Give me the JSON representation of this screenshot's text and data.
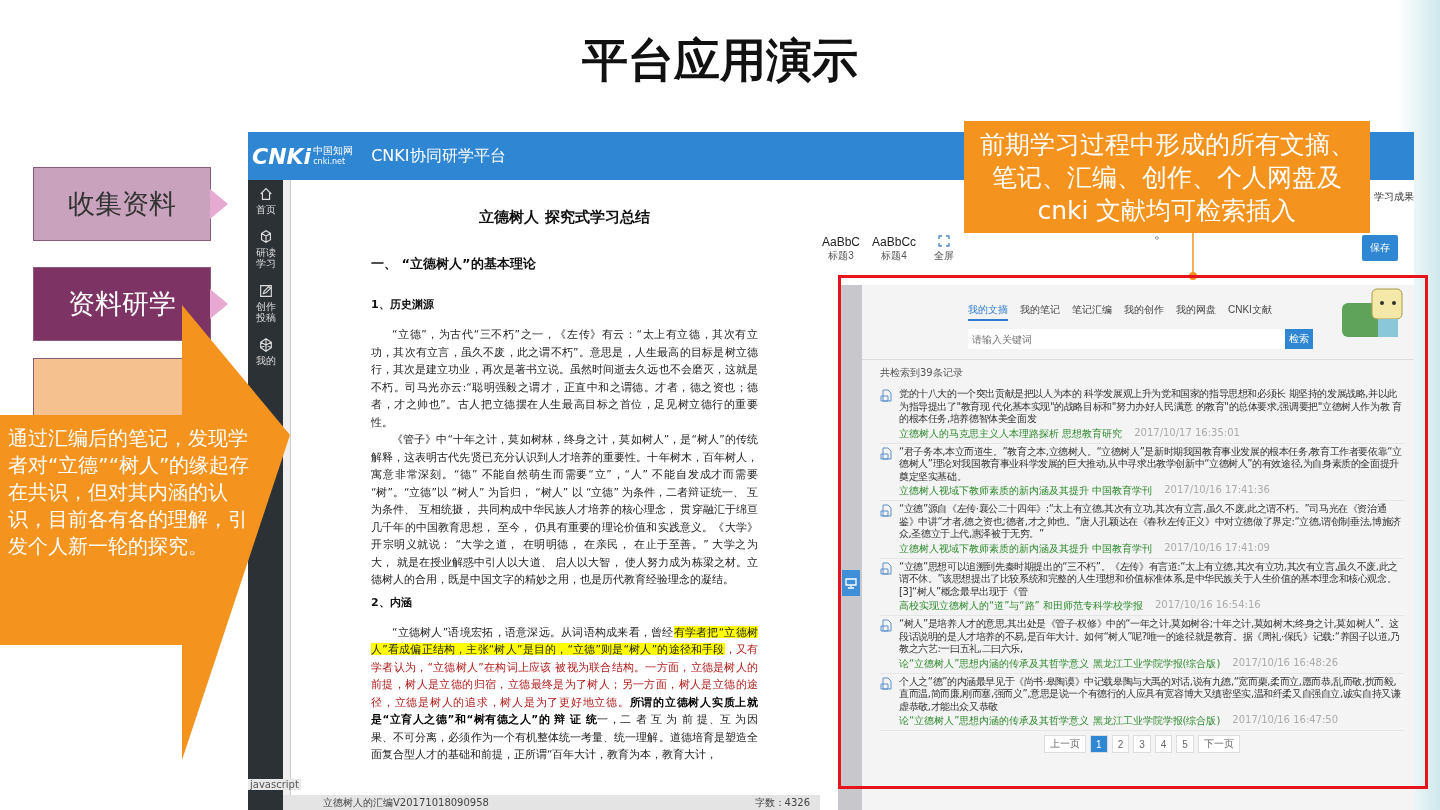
{
  "slide": {
    "title": "平台应用演示",
    "steps": [
      {
        "label": "收集资料",
        "kind": "light"
      },
      {
        "label": "资料研学",
        "kind": "dark"
      },
      {
        "kind": "peach"
      }
    ],
    "arrow_callout": "通过汇编后的笔记，发现学者对“立德”“树人”的缘起存在共识，但对其内涵的认识，目前各有各的理解，引发个人新一轮的探究。",
    "top_callout": "前期学习过程中形成的所有文摘、笔记、汇编、创作、个人网盘及 cnki 文献均可检索插入",
    "stray_mark": "。"
  },
  "app": {
    "logo": "CNKi",
    "logo_cn": "中国知网",
    "logo_url": "cnki.net",
    "title": "CNKI协同研学平台",
    "sidebar": [
      {
        "label": "首页"
      },
      {
        "label": "研读学习"
      },
      {
        "label": "创作投稿"
      },
      {
        "label": "我的"
      }
    ],
    "sidebar_footer": "javascript",
    "toolbar": {
      "styles": [
        {
          "sample": "AaBbC",
          "name": "标题3"
        },
        {
          "sample": "AaBbCc",
          "name": "标题4"
        }
      ],
      "fullscreen": "全屏",
      "save": "保存",
      "right_tab": "学习成果"
    },
    "document": {
      "title": "立德树人  探究式学习总结",
      "blocks": [
        {
          "kind": "h1",
          "text": "一、 “立德树人”的基本理论"
        },
        {
          "kind": "h2",
          "text": "1、历史渊源"
        },
        {
          "kind": "p",
          "segments": [
            {
              "kind": "plain",
              "text": "“立德”，为古代“三不朽”之一，《左传》有云：“太上有立德，其次有立功，其次有立言，虽久不废，此之谓不朽”。意思是，人生最高的目标是树立德行，其次是建立功业，再次是著书立说。虽然时间逝去久远也不会磨灭，这就是不朽。司马光亦云:“聪明强毅之谓才，正直中和之谓德。才者，德之资也；德者，才之帅也”。古人把立德摆在人生最高目标之首位，足见树立德行的重要性。"
            }
          ]
        },
        {
          "kind": "p",
          "segments": [
            {
              "kind": "plain",
              "text": "《管子》中“十年之计，莫如树林，终身之计，莫如树人”，是“树人”的传统解释，这表明古代先贤已充分认识到人才培养的重要性。十年树木，百年树人，寓意非常深刻。“德” 不能自然萌生而需要“立”，“人” 不能自发成才而需要 “树”。“立德”以 “树人” 为旨归， “树人” 以 “立德” 为条件，二者辩证统一、 互为条件、 互相统摄， 共同构成中华民族人才培养的核心理念， 贯穿融汇于绵亘几千年的中国教育思想， 至今， 仍具有重要的理论价值和实践意义。《大学》开宗明义就说： “大学之道， 在明明德， 在亲民， 在止于至善。” 大学之为大， 就是在授业解惑中引人以大道、 启人以大智， 使人努力成为栋梁之材。立德树人的合用，既是中国文字的精妙之用，也是历代教育经验理念的凝结。"
            }
          ]
        },
        {
          "kind": "h2",
          "text": "2、内涵"
        },
        {
          "kind": "p",
          "segments": [
            {
              "kind": "plain",
              "text": "“立德树人”语境宏拓，语意深远。从词语构成来看，曾经"
            },
            {
              "kind": "highlight",
              "text": "有学者把“立德树人”看成偏正结构，主张“树人”是目的，“立德”则是“树人”的途径和手段"
            },
            {
              "kind": "red",
              "text": "，又有学者认为，“立德树人”在构词上应该 被视为联合结构。一方面，立德是树人的前提，树人是立德的归宿，立德最终是为了树人；另一方面，树人是立德的途径，立德是树人的追求，树人是为了更好地立德。"
            },
            {
              "kind": "bold",
              "text": "所谓的立德树人实质上就是“立育人之德”和“树有德之人”的 辩 证 统"
            },
            {
              "kind": "plain",
              "text": "一，二 者 互 为 前 提、互 为因果、不可分离，必须作为一个有机整体统一考量、统一理解。道德培育是塑造全面复合型人才的基础和前提，正所谓“百年大计，教育为本，教育大计，"
            }
          ]
        }
      ],
      "status_name": "立德树人的汇编V20171018090958",
      "status_count": "字数：4326"
    },
    "panel": {
      "tabs": [
        {
          "label": "我的文摘",
          "selected": true
        },
        {
          "label": "我的笔记",
          "selected": false
        },
        {
          "label": "笔记汇编",
          "selected": false
        },
        {
          "label": "我的创作",
          "selected": false
        },
        {
          "label": "我的网盘",
          "selected": false
        },
        {
          "label": "CNKI文献",
          "selected": false
        }
      ],
      "search": {
        "placeholder": "请输入关键词",
        "button": "检索"
      },
      "count": "共检索到39条记录",
      "results": [
        {
          "text": "党的十八大的一个突出贡献是把以人为本的 科学发展观上升为党和国家的指导思想和必须长 期坚持的发展战略,并以此为指导提出了\"教育现 代化基本实现\"的战略目标和\"努力办好人民满意 的教育\"的总体要求,强调要把\"立德树人作为教 育的根本任务,培养德智体美全面发",
          "source": "立德树人的马克思主义人本理路探析 思想教育研究",
          "time": "2017/10/17 16:35:01"
        },
        {
          "text": "“君子务本,本立而道生。”教育之本,立德树人。“立德树人”是新时期我国教育事业发展的根本任务,教育工作者要依靠“立德树人”理论对我国教育事业科学发展的巨大推动,从中寻求出教学创新中“立德树人”的有效途径,为自身素质的全面提升奠定坚实基础。",
          "source": "立德树人视域下教师素质的新内涵及其提升 中国教育学刊",
          "time": "2017/10/16 17:41:36"
        },
        {
          "text": "“立德”源自《左传·襄公二十四年》:“太上有立德,其次有立功,其次有立言,虽久不废,此之谓不朽。”司马光在《资治通鉴》中讲“才者,德之资也;德者,才之帅也。”唐人孔颖达在《春秋左传正义》中对立德做了界定:“立德,谓创制垂法,博施济众,圣德立于上代,惠泽被于无穷。”",
          "source": "立德树人视域下教师素质的新内涵及其提升 中国教育学刊",
          "time": "2017/10/16 17:41:09"
        },
        {
          "text": "“立德”思想可以追溯到先秦时期提出的“三不朽”。《左传》有言道:“太上有立德,其次有立功,其次有立言,虽久不废,此之谓不休。”该思想提出了比较系统和完整的人生理想和价值标准体系,是中华民族关于人生价值的基本理念和核心观念。[3]“树人”概念最早出现于《管",
          "source": "高校实现立德树人的“道”与“路” 和田师范专科学校学报",
          "time": "2017/10/16 16:54:16"
        },
        {
          "text": "“树人”是培养人才的意思,其出处是《管子·权修》中的“一年之计,莫如树谷;十年之计,莫如树木;终身之计,莫如树人”。这段话说明的是人才培养的不易,是百年大计。如何“树人”呢?唯一的途径就是教育。据《周礼·保氏》记载:“养国子以道,乃教之六艺:一曰五礼,二曰六乐,",
          "source": "论“立德树人”思想内涵的传承及其哲学意义 黑龙江工业学院学报(综合版)",
          "time": "2017/10/16 16:48:26"
        },
        {
          "text": "个人之“德”的内涵最早见于《尚书·皋陶谟》中记载皋陶与大禹的对话,说有九德,“宽而栗,柔而立,愿而恭,乱而敬,扰而毅,直而温,简而廉,刚而塞,强而义”,意思是说一个有德行的人应具有宽容博大又缜密坚实,温和纤柔又自强自立,诚实自持又谦虚恭敬,才能出众又恭敬",
          "source": "论“立德树人”思想内涵的传承及其哲学意义 黑龙江工业学院学报(综合版)",
          "time": "2017/10/16 16:47:50"
        }
      ],
      "pagination": [
        {
          "label": "上一页",
          "selected": false
        },
        {
          "label": "1",
          "selected": true
        },
        {
          "label": "2",
          "selected": false
        },
        {
          "label": "3",
          "selected": false
        },
        {
          "label": "4",
          "selected": false
        },
        {
          "label": "5",
          "selected": false
        },
        {
          "label": "下一页",
          "selected": false
        }
      ]
    }
  }
}
